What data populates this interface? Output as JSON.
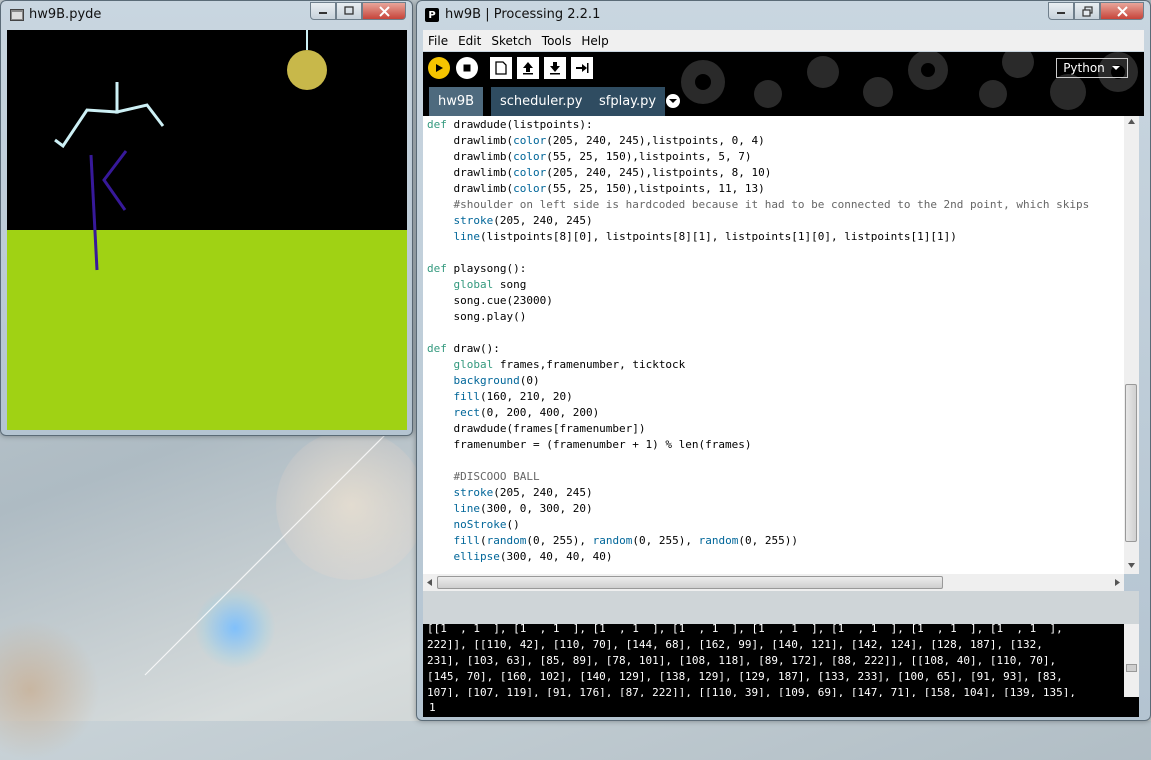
{
  "sketch_window": {
    "title": "hw9B.pyde",
    "controls": [
      "minimize",
      "maximize",
      "close"
    ],
    "canvas": {
      "background": "#000000",
      "ground_color": "#a0d214",
      "ball_color": "#c8b84a",
      "limb_light_color": "#cdf0f5",
      "limb_dark_color": "#37199a"
    }
  },
  "ide_window": {
    "title": "hw9B | Processing 2.2.1",
    "app_icon": "P",
    "menu": [
      "File",
      "Edit",
      "Sketch",
      "Tools",
      "Help"
    ],
    "toolbar": {
      "buttons": [
        "run",
        "stop",
        "new",
        "open",
        "save",
        "export"
      ],
      "mode_label": "Python",
      "mode_icon": "chevron-down-icon"
    },
    "tabs": [
      {
        "label": "hw9B",
        "active": true
      },
      {
        "label": "scheduler.py",
        "active": false
      },
      {
        "label": "sfplay.py",
        "active": false
      }
    ],
    "editor_lines": [
      "def drawdude(listpoints):",
      "    drawlimb(color(205, 240, 245),listpoints, 0, 4)",
      "    drawlimb(color(55, 25, 150),listpoints, 5, 7)",
      "    drawlimb(color(205, 240, 245),listpoints, 8, 10)",
      "    drawlimb(color(55, 25, 150),listpoints, 11, 13)",
      "    #shoulder on left side is hardcoded because it had to be connected to the 2nd point, which skips",
      "    stroke(205, 240, 245)",
      "    line(listpoints[8][0], listpoints[8][1], listpoints[1][0], listpoints[1][1])",
      "",
      "def playsong():",
      "    global song",
      "    song.cue(23000)",
      "    song.play()",
      "",
      "def draw():",
      "    global frames,framenumber, ticktock",
      "    background(0)",
      "    fill(160, 210, 20)",
      "    rect(0, 200, 400, 200)",
      "    drawdude(frames[framenumber])",
      "    framenumber = (framenumber + 1) % len(frames)",
      "",
      "    #DISCOOO BALL",
      "    stroke(205, 240, 245)",
      "    line(300, 0, 300, 20)",
      "    noStroke()",
      "    fill(random(0, 255), random(0, 255), random(0, 255))",
      "    ellipse(300, 40, 40, 40)"
    ],
    "console_lines": [
      "[[1  , 1  ], [1  , 1  ], [1  , 1  ], [1  , 1  ], [1  , 1  ], [1  , 1  ], [1  , 1  ], [1  , 1  ],",
      "222]], [[110, 42], [110, 70], [144, 68], [162, 99], [140, 121], [142, 124], [128, 187], [132,",
      "231], [103, 63], [85, 89], [78, 101], [108, 118], [89, 172], [88, 222]], [[108, 40], [110, 70],",
      "[145, 70], [160, 102], [140, 129], [138, 129], [129, 187], [133, 233], [100, 65], [91, 93], [83,",
      "107], [107, 119], [91, 176], [87, 222]], [[110, 39], [109, 69], [147, 71], [158, 104], [139, 135],"
    ],
    "line_number": "1"
  }
}
